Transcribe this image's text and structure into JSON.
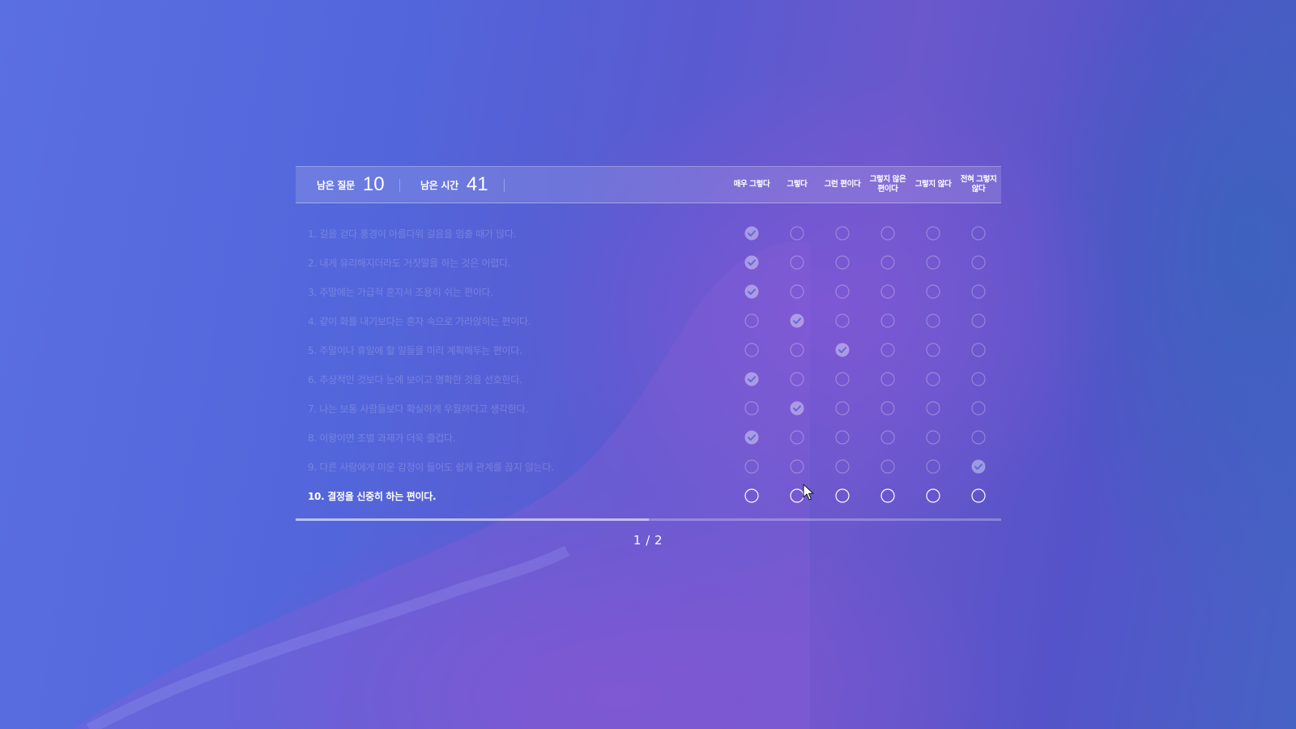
{
  "header": {
    "remaining_questions_label": "남은 질문",
    "remaining_questions_value": "10",
    "remaining_time_label": "남은 시간",
    "remaining_time_value": "41",
    "columns": [
      "매우 그렇다",
      "그렇다",
      "그런 편이다",
      "그렇지 않은\n편이다",
      "그렇지 않다",
      "전혀 그렇지\n않다"
    ]
  },
  "questions": [
    {
      "text": "1. 길을 걷다 풍경이 아름다워 걸음을 멈출 때가 많다.",
      "selected": 0,
      "active": false
    },
    {
      "text": "2. 내게 유리해지더라도 거짓말을 하는 것은 어렵다.",
      "selected": 0,
      "active": false
    },
    {
      "text": "3. 주말에는 가급적 혼자서 조용히 쉬는 편이다.",
      "selected": 0,
      "active": false
    },
    {
      "text": "4. 같이 화를 내기보다는 혼자 속으로 가라앉히는 편이다.",
      "selected": 1,
      "active": false
    },
    {
      "text": "5. 주말이나 휴일에 할 일들을 미리 계획해두는 편이다.",
      "selected": 2,
      "active": false
    },
    {
      "text": "6. 추상적인 것보다 눈에 보이고 명확한 것을 선호한다.",
      "selected": 0,
      "active": false
    },
    {
      "text": "7. 나는 보통 사람들보다 확실하게 우월하다고 생각한다.",
      "selected": 1,
      "active": false
    },
    {
      "text": "8. 이왕이면 조별 과제가 더욱 즐겁다.",
      "selected": 0,
      "active": false
    },
    {
      "text": "9. 다른 사람에게 미운 감정이 들어도 쉽게 관계를 끊지 않는다.",
      "selected": 5,
      "active": false
    },
    {
      "text": "10. 결정을 신중히 하는 편이다.",
      "selected": null,
      "active": true
    }
  ],
  "progress": {
    "fraction": 0.5,
    "page_label": "1 / 2"
  },
  "icons": {
    "selected": "check-circle-icon",
    "unselected": "radio-circle-icon",
    "cursor": "mouse-pointer-icon"
  }
}
